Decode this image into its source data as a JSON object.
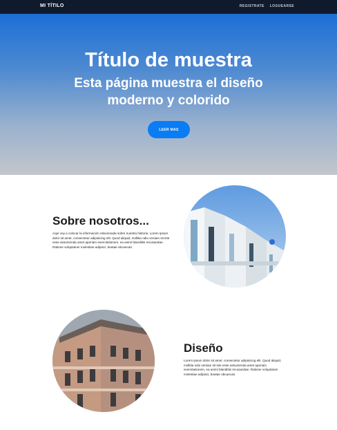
{
  "nav": {
    "brand": "MI TÍTILO",
    "links": [
      "REGISTRATE",
      "LOGUEARSE"
    ]
  },
  "hero": {
    "title": "Título de muestra",
    "subtitle": "Esta página muestra el diseño moderno y colorido",
    "button": "LEER MAS"
  },
  "about": {
    "title": "Sobre nosotros...",
    "text": "Aquí voy a colocar la información relacionada sobre nuestra historia. Lorem ipsum dolor sit amet, consectetur adipisicing elit. Quod aliquid, mollitia odio veniam sit iste esse assumenda amet aperiam exercitationem, ea animi blanditiis recusandae. Ratione voluptatum molestiae adipisci, beatae obcaecati."
  },
  "design": {
    "title": "Diseño",
    "text": "Lorem ipsum dolor sit amet, consectetur adipisicing elit. Quod aliquid, mollitia odio veniam sit iste esse assumenda amet aperiam exercitationem, ea animi blanditiis recusandae. Ratione voluptatum molestiae adipisci, beatae obcaecati."
  },
  "colors": {
    "nav_bg": "#0f1b2c",
    "hero_top": "#1c6fd7",
    "hero_bottom": "#c3c6cc",
    "button": "#0a7cf4"
  }
}
